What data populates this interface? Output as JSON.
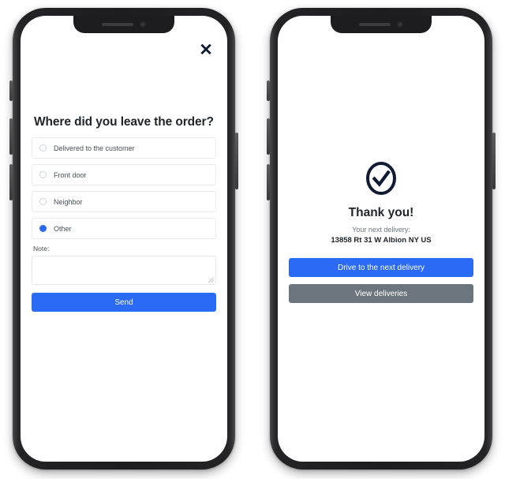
{
  "theme": {
    "primary_color": "#2a6af5",
    "secondary_color": "#6c757d",
    "text_color": "#212529",
    "muted_text_color": "#6c757d",
    "border_color": "#e9ecef",
    "screen_background": "#ffffff",
    "frame_color": "#1d1d1f"
  },
  "left_phone": {
    "close_icon": "close-icon",
    "close_glyph": "✕",
    "title": "Where did you leave the order?",
    "options": [
      {
        "label": "Delivered to the customer",
        "selected": false
      },
      {
        "label": "Front door",
        "selected": false
      },
      {
        "label": "Neighbor",
        "selected": false
      },
      {
        "label": "Other",
        "selected": true
      }
    ],
    "note_label": "Note:",
    "note_value": "",
    "note_placeholder": "",
    "submit_label": "Send"
  },
  "right_phone": {
    "status_icon": "check-circle-icon",
    "title": "Thank you!",
    "subtitle": "Your next delivery:",
    "address": "13858 Rt 31 W Albion NY US",
    "primary_button_label": "Drive to the next delivery",
    "secondary_button_label": "View deliveries"
  }
}
